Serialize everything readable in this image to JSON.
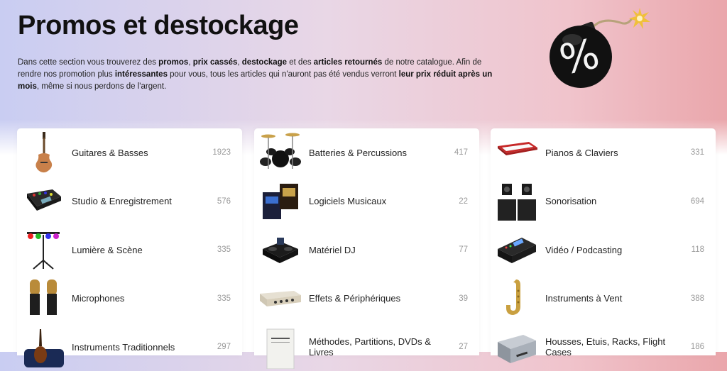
{
  "page": {
    "title": "Promos et destockage",
    "intro": [
      {
        "t": "Dans cette section vous trouverez des ",
        "b": false
      },
      {
        "t": "promos",
        "b": true
      },
      {
        "t": ", ",
        "b": false
      },
      {
        "t": "prix cassés",
        "b": true
      },
      {
        "t": ", ",
        "b": false
      },
      {
        "t": "destockage",
        "b": true
      },
      {
        "t": " et des ",
        "b": false
      },
      {
        "t": "articles retournés",
        "b": true
      },
      {
        "t": " de notre catalogue. Afin de rendre nos promotion plus ",
        "b": false
      },
      {
        "t": "intéressantes",
        "b": true
      },
      {
        "t": " pour vous, tous les articles qui n'auront pas été vendus verront ",
        "b": false
      },
      {
        "t": "leur prix réduit après un mois",
        "b": true
      },
      {
        "t": ", même si nous perdons de l'argent.",
        "b": false
      }
    ],
    "badge_icon": "percent-bomb-icon"
  },
  "columns": [
    [
      {
        "label": "Guitares & Basses",
        "count": "1923",
        "icon": "guitar-icon"
      },
      {
        "label": "Studio & Enregistrement",
        "count": "576",
        "icon": "mixer-icon"
      },
      {
        "label": "Lumière & Scène",
        "count": "335",
        "icon": "stage-light-icon"
      },
      {
        "label": "Microphones",
        "count": "335",
        "icon": "microphone-icon"
      },
      {
        "label": "Instruments Traditionnels",
        "count": "297",
        "icon": "violin-icon"
      }
    ],
    [
      {
        "label": "Batteries & Percussions",
        "count": "417",
        "icon": "drum-kit-icon"
      },
      {
        "label": "Logiciels Musicaux",
        "count": "22",
        "icon": "software-box-icon"
      },
      {
        "label": "Matériel DJ",
        "count": "77",
        "icon": "dj-controller-icon"
      },
      {
        "label": "Effets & Périphériques",
        "count": "39",
        "icon": "rack-unit-icon"
      },
      {
        "label": "Méthodes, Partitions, DVDs & Livres",
        "count": "27",
        "icon": "book-icon"
      }
    ],
    [
      {
        "label": "Pianos & Claviers",
        "count": "331",
        "icon": "keyboard-icon"
      },
      {
        "label": "Sonorisation",
        "count": "694",
        "icon": "speakers-icon"
      },
      {
        "label": "Vidéo / Podcasting",
        "count": "118",
        "icon": "video-switcher-icon"
      },
      {
        "label": "Instruments à Vent",
        "count": "388",
        "icon": "saxophone-icon"
      },
      {
        "label": "Housses, Etuis, Racks, Flight Cases",
        "count": "186",
        "icon": "flight-case-icon"
      }
    ]
  ]
}
